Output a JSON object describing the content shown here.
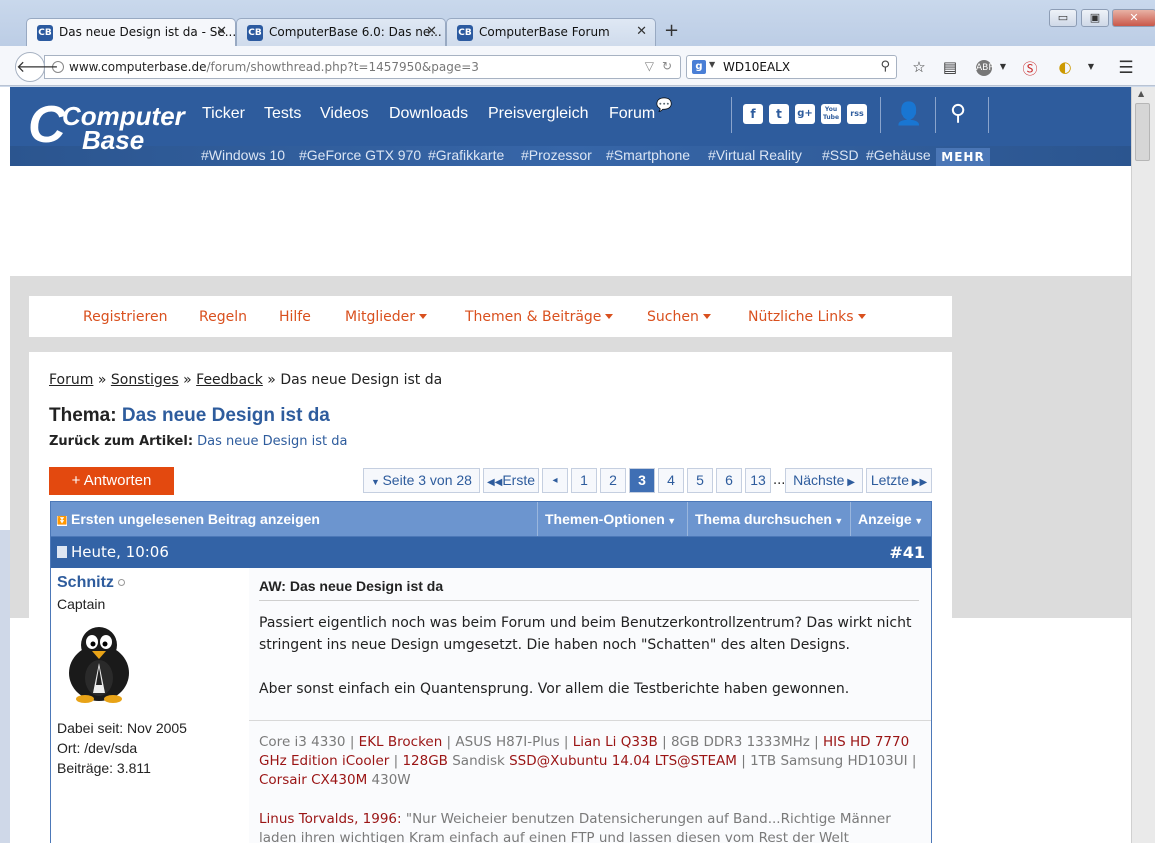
{
  "browser": {
    "tabs": [
      {
        "title": "Das neue Design ist da - Se...",
        "favicon": "CB"
      },
      {
        "title": "ComputerBase 6.0: Das ne...",
        "favicon": "CB"
      },
      {
        "title": "ComputerBase Forum",
        "favicon": "CB"
      }
    ],
    "new_tab": "+",
    "url_domain": "www.computerbase.de",
    "url_path": "/forum/showthread.php?t=1457950&page=3",
    "search_value": "WD10EALX",
    "search_engine": "g",
    "window_buttons": {
      "minimize": "▭",
      "maximize": "▣",
      "close": "✕"
    }
  },
  "site": {
    "logo_top": "Computer",
    "logo_bottom": "Base",
    "logo_c": "C",
    "nav": [
      "Ticker",
      "Tests",
      "Videos",
      "Downloads",
      "Preisvergleich",
      "Forum"
    ],
    "social": [
      "f",
      "t",
      "g+",
      "You Tube",
      "rss"
    ],
    "tags": [
      "#Windows 10",
      "#GeForce GTX 970",
      "#Grafikkarte",
      "#Prozessor",
      "#Smartphone",
      "#Virtual Reality",
      "#SSD",
      "#Gehäuse"
    ],
    "more": "MEHR"
  },
  "forumnav": {
    "items": [
      {
        "label": "Registrieren",
        "dropdown": false
      },
      {
        "label": "Regeln",
        "dropdown": false
      },
      {
        "label": "Hilfe",
        "dropdown": false
      },
      {
        "label": "Mitglieder",
        "dropdown": true
      },
      {
        "label": "Themen & Beiträge",
        "dropdown": true
      },
      {
        "label": "Suchen",
        "dropdown": true
      },
      {
        "label": "Nützliche Links",
        "dropdown": true
      }
    ]
  },
  "breadcrumb": {
    "items": [
      "Forum",
      "Sonstiges",
      "Feedback"
    ],
    "sep": "»",
    "current": "Das neue Design ist da"
  },
  "thread": {
    "title_label": "Thema:",
    "title": "Das neue Design ist da",
    "back_label": "Zurück zum Artikel:",
    "back_link": "Das neue Design ist da",
    "reply_button": "+ Antworten"
  },
  "pagination": {
    "page_info": "Seite 3 von 28",
    "first": "Erste",
    "prev": "◂",
    "pages": [
      "1",
      "2",
      "3",
      "4",
      "5",
      "6",
      "13"
    ],
    "current": "3",
    "ellipsis": "...",
    "next": "Nächste",
    "last": "Letzte"
  },
  "thread_controls": {
    "unread": "Ersten ungelesenen Beitrag anzeigen",
    "options": "Themen-Optionen",
    "search": "Thema durchsuchen",
    "display": "Anzeige"
  },
  "post": {
    "date": "Heute, 10:06",
    "number": "#41",
    "author": "Schnitz",
    "rank": "Captain",
    "joined": "Dabei seit: Nov 2005",
    "location": "Ort: /dev/sda",
    "posts": "Beiträge: 3.811",
    "title": "AW: Das neue Design ist da",
    "paragraph1": "Passiert eigentlich noch was beim Forum und beim Benutzerkontrollzentrum? Das wirkt nicht stringent ins neue Design umgesetzt. Die haben noch \"Schatten\" des alten Designs.",
    "paragraph2": "Aber sonst einfach ein Quantensprung. Vor allem die Testberichte haben gewonnen.",
    "signature": {
      "items": [
        {
          "text": "Core i3 4330",
          "link": false
        },
        {
          "text": "EKL Brocken",
          "link": true
        },
        {
          "text": "ASUS H87I-Plus",
          "link": false
        },
        {
          "text": "Lian Li Q33B",
          "link": true
        },
        {
          "text": "8GB DDR3 1333MHz",
          "link": false
        },
        {
          "text": "HIS HD 7770 GHz Edition iCooler",
          "link": true
        },
        {
          "text": "128GB",
          "link": true
        },
        {
          "text": "Sandisk",
          "link": false
        },
        {
          "text": "SSD@Xubuntu 14.04 LTS@STEAM",
          "link": true
        },
        {
          "text": "1TB Samsung HD103UI",
          "link": false
        },
        {
          "text": "Corsair CX430M",
          "link": true
        },
        {
          "text": "430W",
          "link": false
        }
      ],
      "quote_author": "Linus Torvalds, 1996:",
      "quote_text": "\"Nur Weicheier benutzen Datensicherungen auf Band...Richtige Männer laden ihren wichtigen Kram einfach auf einen FTP und lassen diesen vom Rest der Welt"
    }
  },
  "colors": {
    "brand_blue": "#2e5c9d",
    "accent_orange": "#e3490f",
    "link_red": "#9a1414"
  }
}
